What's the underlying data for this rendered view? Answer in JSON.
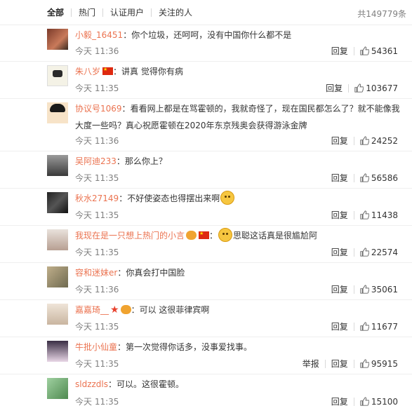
{
  "tabs": [
    {
      "label": "全部",
      "active": true
    },
    {
      "label": "热门",
      "active": false
    },
    {
      "label": "认证用户",
      "active": false
    },
    {
      "label": "关注的人",
      "active": false
    }
  ],
  "total": "共149779条",
  "reply_label": "回复",
  "report_label": "举报",
  "comments": [
    {
      "user": "小毅_16451",
      "text": "你个垃圾，还呵呵，没有中国你什么都不是",
      "time": "今天 11:36",
      "likes": "54361"
    },
    {
      "user": "朱八岁",
      "text": "讲真 觉得你有病",
      "time": "今天 11:35",
      "likes": "103677"
    },
    {
      "user": "协议号1069",
      "text": "看看网上都是在骂霍顿的，我就奇怪了，现在国民都怎么了？就不能像我大度一些吗？真心祝愿霍顿在2020年东京残奥会获得游泳金牌",
      "time": "今天 11:36",
      "likes": "24252"
    },
    {
      "user": "吴阿迪233",
      "text": "那么你上？",
      "time": "今天 11:35",
      "likes": "56586"
    },
    {
      "user": "秋水27149",
      "text": "不好使姿态也得摆出来啊",
      "time": "今天 11:35",
      "likes": "11438"
    },
    {
      "user": "我现在是一只想上热门的小言",
      "text": "思聪这话真是很尴尬阿",
      "time": "今天 11:35",
      "likes": "22574"
    },
    {
      "user": "容和迷妹er",
      "text": "你真会打中国脸",
      "time": "今天 11:36",
      "likes": "35061"
    },
    {
      "user": "嘉嘉琦__",
      "text": "可以 这很菲律宾啊",
      "time": "今天 11:35",
      "likes": "11677"
    },
    {
      "user": "牛批小仙童",
      "text": "第一次觉得你话多，没事爱找事。",
      "time": "今天 11:35",
      "likes": "95915"
    },
    {
      "user": "sldzzdls",
      "text": "可以。这很霍顿。",
      "time": "今天 11:35",
      "likes": "15100"
    }
  ],
  "colors": {
    "username": "#eb7350",
    "meta": "#808080",
    "text": "#333333"
  }
}
